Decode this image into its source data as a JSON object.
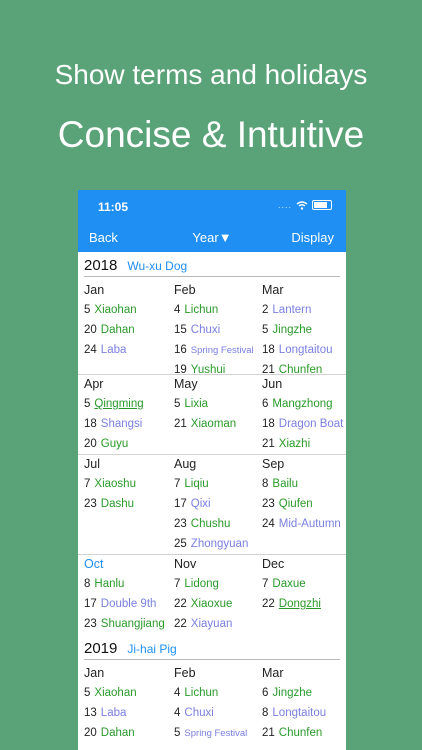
{
  "hero": {
    "line1": "Show terms and holidays",
    "line2": "Concise & Intuitive"
  },
  "status_bar": {
    "time": "11:05",
    "signal": "....",
    "wifi": "wifi-icon"
  },
  "nav": {
    "back": "Back",
    "year_selector": "Year▼",
    "display": "Display"
  },
  "colors": {
    "background": "#5aa277",
    "nav_blue": "#1f8ff3",
    "term_green": "#2a9a2a",
    "holiday_purple": "#7a7fe0"
  },
  "years": [
    {
      "year": "2018",
      "ganzhi": "Wu-xu  Dog",
      "quarters": [
        [
          {
            "name": "Jan",
            "entries": [
              {
                "day": "5",
                "label": "Xiaohan",
                "kind": "term"
              },
              {
                "day": "20",
                "label": "Dahan",
                "kind": "term"
              },
              {
                "day": "24",
                "label": "Laba",
                "kind": "holiday"
              }
            ]
          },
          {
            "name": "Feb",
            "entries": [
              {
                "day": "4",
                "label": "Lichun",
                "kind": "term"
              },
              {
                "day": "15",
                "label": "Chuxi",
                "kind": "holiday"
              },
              {
                "day": "16",
                "label": "Spring Festival",
                "kind": "holiday",
                "small": true
              },
              {
                "day": "19",
                "label": "Yushui",
                "kind": "term"
              }
            ]
          },
          {
            "name": "Mar",
            "entries": [
              {
                "day": "2",
                "label": "Lantern",
                "kind": "holiday"
              },
              {
                "day": "5",
                "label": "Jingzhe",
                "kind": "term"
              },
              {
                "day": "18",
                "label": "Longtaitou",
                "kind": "holiday"
              },
              {
                "day": "21",
                "label": "Chunfen",
                "kind": "term"
              }
            ]
          }
        ],
        [
          {
            "name": "Apr",
            "entries": [
              {
                "day": "5",
                "label": "Qingming",
                "kind": "term",
                "underline": true
              },
              {
                "day": "18",
                "label": "Shangsi",
                "kind": "holiday"
              },
              {
                "day": "20",
                "label": "Guyu",
                "kind": "term"
              }
            ]
          },
          {
            "name": "May",
            "entries": [
              {
                "day": "5",
                "label": "Lixia",
                "kind": "term"
              },
              {
                "day": "21",
                "label": "Xiaoman",
                "kind": "term"
              }
            ]
          },
          {
            "name": "Jun",
            "entries": [
              {
                "day": "6",
                "label": "Mangzhong",
                "kind": "term"
              },
              {
                "day": "18",
                "label": "Dragon Boat",
                "kind": "holiday"
              },
              {
                "day": "21",
                "label": "Xiazhi",
                "kind": "term"
              }
            ]
          }
        ],
        [
          {
            "name": "Jul",
            "entries": [
              {
                "day": "7",
                "label": "Xiaoshu",
                "kind": "term"
              },
              {
                "day": "23",
                "label": "Dashu",
                "kind": "term"
              }
            ]
          },
          {
            "name": "Aug",
            "entries": [
              {
                "day": "7",
                "label": "Liqiu",
                "kind": "term"
              },
              {
                "day": "17",
                "label": "Qixi",
                "kind": "holiday"
              },
              {
                "day": "23",
                "label": "Chushu",
                "kind": "term"
              },
              {
                "day": "25",
                "label": "Zhongyuan",
                "kind": "holiday"
              }
            ]
          },
          {
            "name": "Sep",
            "entries": [
              {
                "day": "8",
                "label": "Bailu",
                "kind": "term"
              },
              {
                "day": "23",
                "label": "Qiufen",
                "kind": "term"
              },
              {
                "day": "24",
                "label": "Mid-Autumn",
                "kind": "holiday"
              }
            ]
          }
        ],
        [
          {
            "name": "Oct",
            "special": true,
            "entries": [
              {
                "day": "8",
                "label": "Hanlu",
                "kind": "term"
              },
              {
                "day": "17",
                "label": "Double 9th",
                "kind": "holiday"
              },
              {
                "day": "23",
                "label": "Shuangjiang",
                "kind": "term"
              }
            ]
          },
          {
            "name": "Nov",
            "entries": [
              {
                "day": "7",
                "label": "Lidong",
                "kind": "term"
              },
              {
                "day": "22",
                "label": "Xiaoxue",
                "kind": "term"
              },
              {
                "day": "22",
                "label": "Xiayuan",
                "kind": "holiday"
              }
            ]
          },
          {
            "name": "Dec",
            "entries": [
              {
                "day": "7",
                "label": "Daxue",
                "kind": "term"
              },
              {
                "day": "22",
                "label": "Dongzhi",
                "kind": "term",
                "underline": true
              }
            ]
          }
        ]
      ]
    },
    {
      "year": "2019",
      "ganzhi": "Ji-hai  Pig",
      "quarters": [
        [
          {
            "name": "Jan",
            "entries": [
              {
                "day": "5",
                "label": "Xiaohan",
                "kind": "term"
              },
              {
                "day": "13",
                "label": "Laba",
                "kind": "holiday"
              },
              {
                "day": "20",
                "label": "Dahan",
                "kind": "term"
              }
            ]
          },
          {
            "name": "Feb",
            "entries": [
              {
                "day": "4",
                "label": "Lichun",
                "kind": "term"
              },
              {
                "day": "4",
                "label": "Chuxi",
                "kind": "holiday"
              },
              {
                "day": "5",
                "label": "Spring Festival",
                "kind": "holiday",
                "small": true
              }
            ]
          },
          {
            "name": "Mar",
            "entries": [
              {
                "day": "6",
                "label": "Jingzhe",
                "kind": "term"
              },
              {
                "day": "8",
                "label": "Longtaitou",
                "kind": "holiday"
              },
              {
                "day": "21",
                "label": "Chunfen",
                "kind": "term"
              }
            ]
          }
        ]
      ]
    }
  ]
}
